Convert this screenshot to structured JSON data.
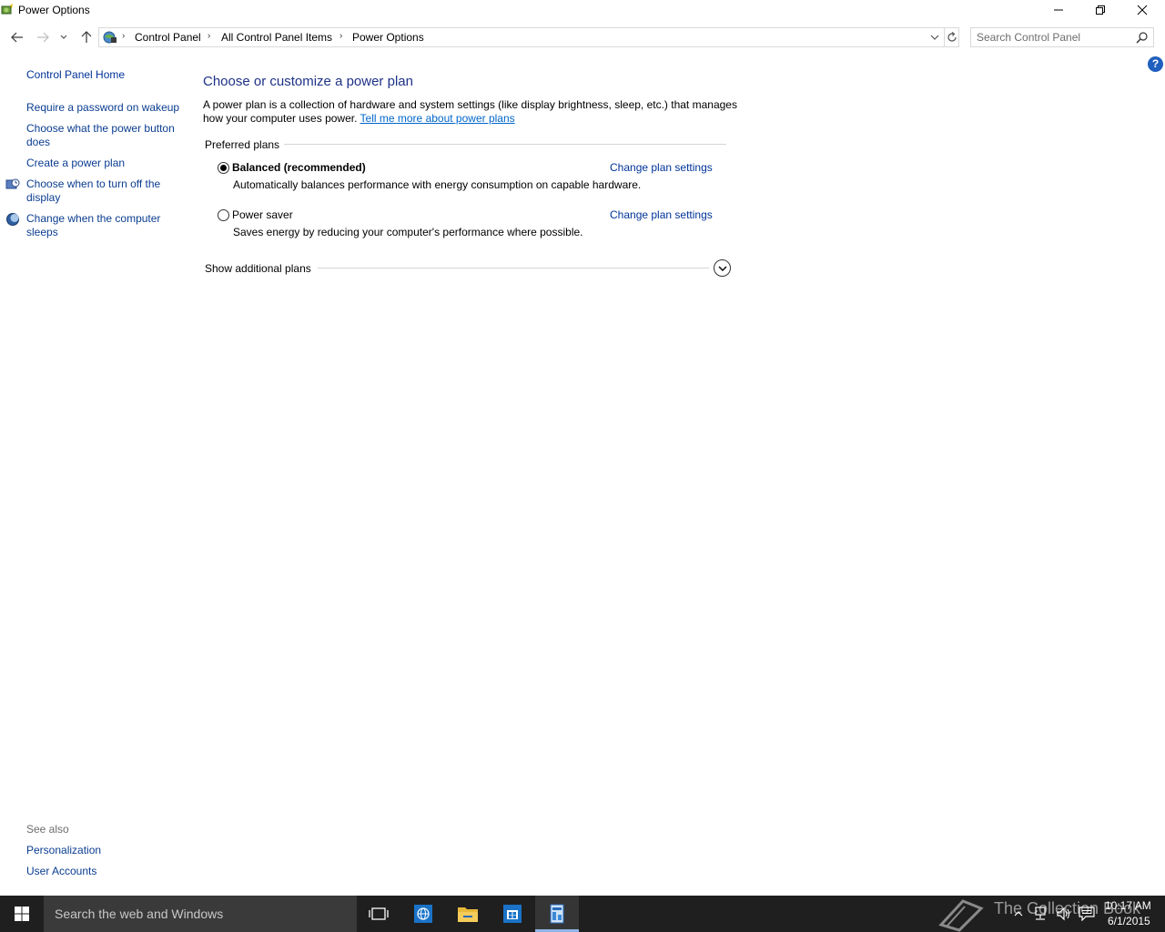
{
  "window": {
    "title": "Power Options",
    "icon": "power-options-icon"
  },
  "address": {
    "crumbs": [
      "Control Panel",
      "All Control Panel Items",
      "Power Options"
    ],
    "separator": "›"
  },
  "search": {
    "placeholder": "Search Control Panel",
    "value": ""
  },
  "help": {
    "label": "?"
  },
  "left_nav": {
    "home": "Control Panel Home",
    "items": [
      {
        "label": "Require a password on wakeup",
        "icon": ""
      },
      {
        "label": "Choose what the power button does",
        "icon": ""
      },
      {
        "label": "Create a power plan",
        "icon": ""
      },
      {
        "label": "Choose when to turn off the display",
        "icon": "display-clock-icon"
      },
      {
        "label": "Change when the computer sleeps",
        "icon": "moon-sleep-icon"
      }
    ],
    "see_also": {
      "heading": "See also",
      "items": [
        "Personalization",
        "User Accounts"
      ]
    }
  },
  "main": {
    "title": "Choose or customize a power plan",
    "description": "A power plan is a collection of hardware and system settings (like display brightness, sleep, etc.) that manages how your computer uses power.",
    "learn_more": "Tell me more about power plans",
    "preferred_label": "Preferred plans",
    "plans": [
      {
        "name": "Balanced (recommended)",
        "description": "Automatically balances performance with energy consumption on capable hardware.",
        "selected": true,
        "link": "Change plan settings"
      },
      {
        "name": "Power saver",
        "description": "Saves energy by reducing your computer's performance where possible.",
        "selected": false,
        "link": "Change plan settings"
      }
    ],
    "additional_label": "Show additional plans"
  },
  "taskbar": {
    "search_placeholder": "Search the web and Windows",
    "watermark": "The Collection Book",
    "time": "10:17 AM",
    "date": "6/1/2015",
    "colors": {
      "background": "#1f1f1f",
      "search": "#3a3a3a",
      "active": "#8fb5e6"
    }
  },
  "colors": {
    "title_blue": "#1e3287",
    "link_blue": "#003399",
    "hyperlink": "#0066cc"
  }
}
